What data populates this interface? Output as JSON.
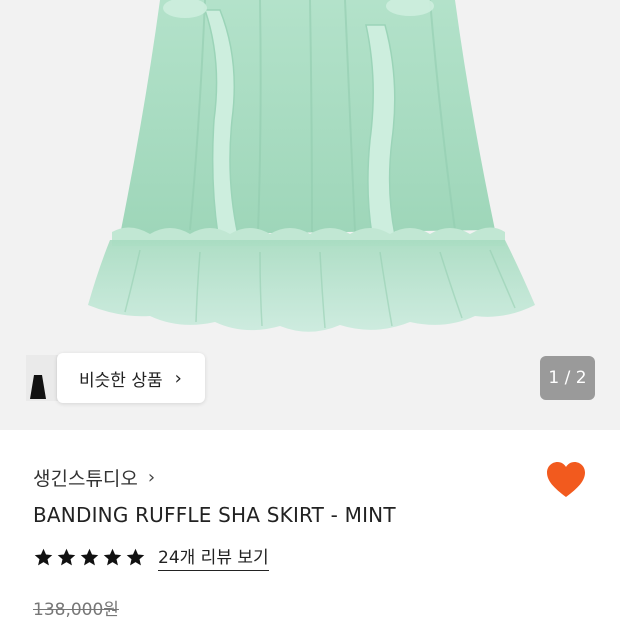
{
  "product_image": {
    "similar_button_label": "비슷한 상품",
    "pager_text": "1 / 2",
    "colors": {
      "background": "#f2f2f2",
      "skirt": "#a9dcc2"
    }
  },
  "product": {
    "brand": "생긴스튜디오",
    "name": "BANDING RUFFLE SHA SKIRT - MINT",
    "review_link": "24개 리뷰 보기",
    "rating_stars": 5,
    "original_price": "138,000원"
  },
  "icons": {
    "wishlist": "heart-icon",
    "star": "star-icon",
    "chevron": "chevron-right-icon"
  },
  "colors": {
    "accent": "#f25a1e",
    "star": "#111111"
  }
}
